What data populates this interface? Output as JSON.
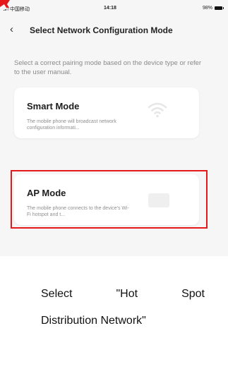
{
  "status_bar": {
    "carrier": "中国移动",
    "time": "14:18",
    "battery": "98%"
  },
  "header": {
    "title": "Select Network Configuration Mode"
  },
  "subtitle": "Select a correct pairing mode based on the device type or refer to the user manual.",
  "modes": [
    {
      "title": "Smart Mode",
      "description": "The mobile phone will broadcast network configuration informati..."
    },
    {
      "title": "AP Mode",
      "description": "The mobile phone connects to the device's Wi-Fi hotspot and t..."
    }
  ],
  "annotation": {
    "highlight_color": "#e51919",
    "caption_words": [
      "Select",
      "\"Hot",
      "Spot"
    ],
    "caption_line2": "Distribution Network\""
  }
}
